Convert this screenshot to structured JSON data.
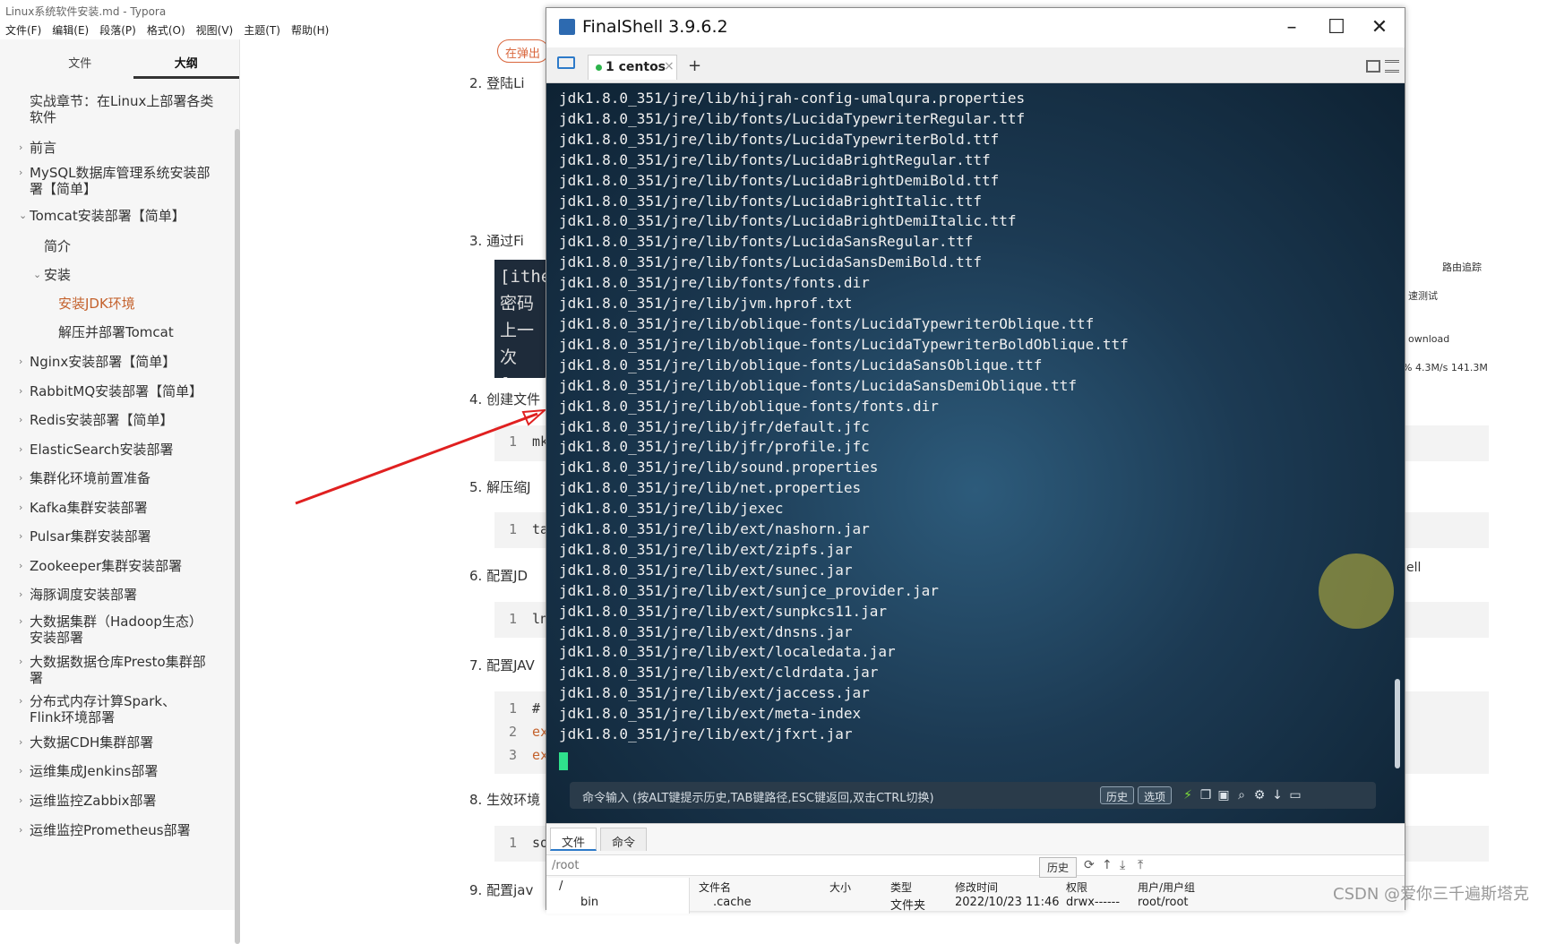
{
  "typora": {
    "title": "Linux系统软件安装.md - Typora",
    "menu": [
      "文件(F)",
      "编辑(E)",
      "段落(P)",
      "格式(O)",
      "视图(V)",
      "主题(T)",
      "帮助(H)"
    ],
    "sidebar_tabs": [
      "文件",
      "大纲"
    ],
    "outline": [
      "实战章节：在Linux上部署各类软件",
      "前言",
      "MySQL数据库管理系统安装部署【简单】",
      "Tomcat安装部署【简单】",
      "简介",
      "安装",
      "安装JDK环境",
      "解压并部署Tomcat",
      "Nginx安装部署【简单】",
      "RabbitMQ安装部署【简单】",
      "Redis安装部署【简单】",
      "ElasticSearch安装部署",
      "集群化环境前置准备",
      "Kafka集群安装部署",
      "Pulsar集群安装部署",
      "Zookeeper集群安装部署",
      "海豚调度安装部署",
      "大数据集群（Hadoop生态）安装部署",
      "大数据数据仓库Presto集群部署",
      "分布式内存计算Spark、Flink环境部署",
      "大数据CDH集群部署",
      "运维集成Jenkins部署",
      "运维监控Zabbix部署",
      "运维监控Prometheus部署"
    ],
    "doc": {
      "pill": "在弹出",
      "steps": [
        "2. 登陆Li",
        "3. 通过Fi",
        "4. 创建文件",
        "5. 解压缩J",
        "6. 配置JD",
        "7. 配置JAV",
        "8. 生效环境",
        "9. 配置jav"
      ],
      "term_img_lines": [
        "[ithe",
        "密码",
        "上一次",
        "[root"
      ],
      "code_nums": [
        "1",
        "1",
        "1",
        "1",
        "2",
        "3",
        "1"
      ],
      "code_texts": [
        "mk",
        "ta",
        "ln",
        "#",
        "ex",
        "ex",
        "so"
      ],
      "right_labels": [
        "路由追踪",
        "速测试",
        "ownload",
        "% 4.3M/s 141.3M",
        "ell"
      ]
    }
  },
  "finalshell": {
    "title": "FinalShell 3.9.6.2",
    "tab_label": "1 centos",
    "terminal_lines": [
      "jdk1.8.0_351/jre/lib/hijrah-config-umalqura.properties",
      "jdk1.8.0_351/jre/lib/fonts/LucidaTypewriterRegular.ttf",
      "jdk1.8.0_351/jre/lib/fonts/LucidaTypewriterBold.ttf",
      "jdk1.8.0_351/jre/lib/fonts/LucidaBrightRegular.ttf",
      "jdk1.8.0_351/jre/lib/fonts/LucidaBrightDemiBold.ttf",
      "jdk1.8.0_351/jre/lib/fonts/LucidaBrightItalic.ttf",
      "jdk1.8.0_351/jre/lib/fonts/LucidaBrightDemiItalic.ttf",
      "jdk1.8.0_351/jre/lib/fonts/LucidaSansRegular.ttf",
      "jdk1.8.0_351/jre/lib/fonts/LucidaSansDemiBold.ttf",
      "jdk1.8.0_351/jre/lib/fonts/fonts.dir",
      "jdk1.8.0_351/jre/lib/jvm.hprof.txt",
      "jdk1.8.0_351/jre/lib/oblique-fonts/LucidaTypewriterOblique.ttf",
      "jdk1.8.0_351/jre/lib/oblique-fonts/LucidaTypewriterBoldOblique.ttf",
      "jdk1.8.0_351/jre/lib/oblique-fonts/LucidaSansOblique.ttf",
      "jdk1.8.0_351/jre/lib/oblique-fonts/LucidaSansDemiOblique.ttf",
      "jdk1.8.0_351/jre/lib/oblique-fonts/fonts.dir",
      "jdk1.8.0_351/jre/lib/jfr/default.jfc",
      "jdk1.8.0_351/jre/lib/jfr/profile.jfc",
      "jdk1.8.0_351/jre/lib/sound.properties",
      "jdk1.8.0_351/jre/lib/net.properties",
      "jdk1.8.0_351/jre/lib/jexec",
      "jdk1.8.0_351/jre/lib/ext/nashorn.jar",
      "jdk1.8.0_351/jre/lib/ext/zipfs.jar",
      "jdk1.8.0_351/jre/lib/ext/sunec.jar",
      "jdk1.8.0_351/jre/lib/ext/sunjce_provider.jar",
      "jdk1.8.0_351/jre/lib/ext/sunpkcs11.jar",
      "jdk1.8.0_351/jre/lib/ext/dnsns.jar",
      "jdk1.8.0_351/jre/lib/ext/localedata.jar",
      "jdk1.8.0_351/jre/lib/ext/cldrdata.jar",
      "jdk1.8.0_351/jre/lib/ext/jaccess.jar",
      "jdk1.8.0_351/jre/lib/ext/meta-index",
      "jdk1.8.0_351/jre/lib/ext/jfxrt.jar"
    ],
    "cmd_hint": "命令输入 (按ALT键提示历史,TAB键路径,ESC键返回,双击CTRL切换)",
    "cmd_buttons": [
      "历史",
      "选项"
    ],
    "bottom_tabs": [
      "文件",
      "命令"
    ],
    "path": "/root",
    "history_label": "历史",
    "tree": [
      "/",
      "bin"
    ],
    "file_headers": [
      "文件名",
      "大小",
      "类型",
      "修改时间",
      "权限",
      "用户/用户组"
    ],
    "file_row": {
      "name": ".cache",
      "type": "文件夹",
      "mtime": "2022/10/23 11:46",
      "perm": "drwx------",
      "owner": "root/root"
    }
  },
  "watermark": "CSDN @爱你三千遍斯塔克",
  "colors": {
    "accent": "#c4622d",
    "terminal_bg": "#1c3a53",
    "cursor": "#2fe08c",
    "arrow": "#e02020"
  }
}
